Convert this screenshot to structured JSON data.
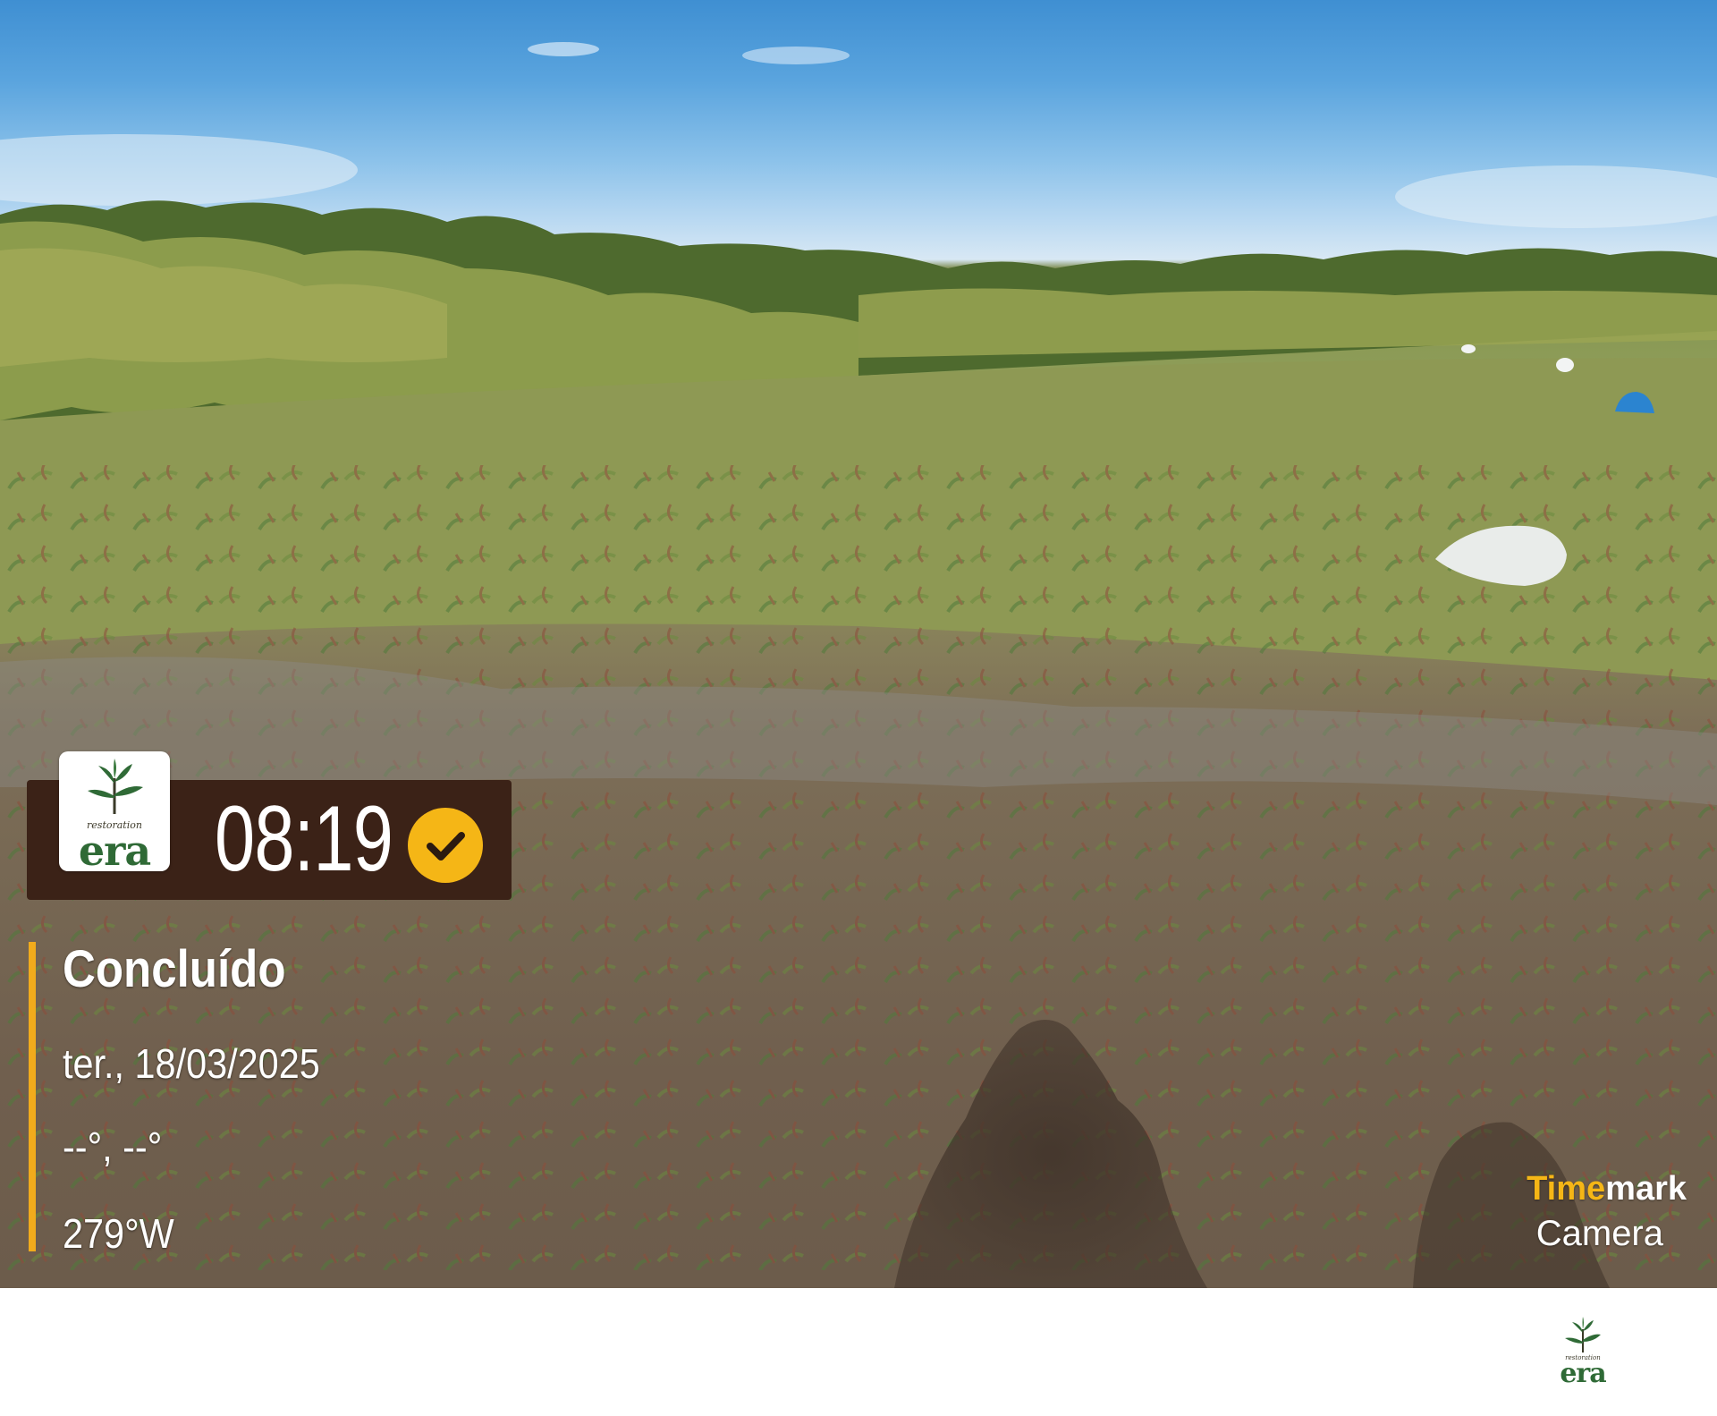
{
  "badge": {
    "time": "08:19",
    "check_icon": "checkmark-icon",
    "accent_color": "#f5b616"
  },
  "logo": {
    "small_text": "restoration",
    "brand_text": "era",
    "icon": "seedling-icon"
  },
  "info": {
    "status": "Concluído",
    "date": "ter., 18/03/2025",
    "coordinates": "--°, --°",
    "heading": "279°W",
    "bar_color": "#f1ab1c"
  },
  "watermark": {
    "accent_part": "Time",
    "rest_part": "mark",
    "line2": "Camera"
  },
  "footer_logo": {
    "small_text": "restoration",
    "brand_text": "era"
  }
}
